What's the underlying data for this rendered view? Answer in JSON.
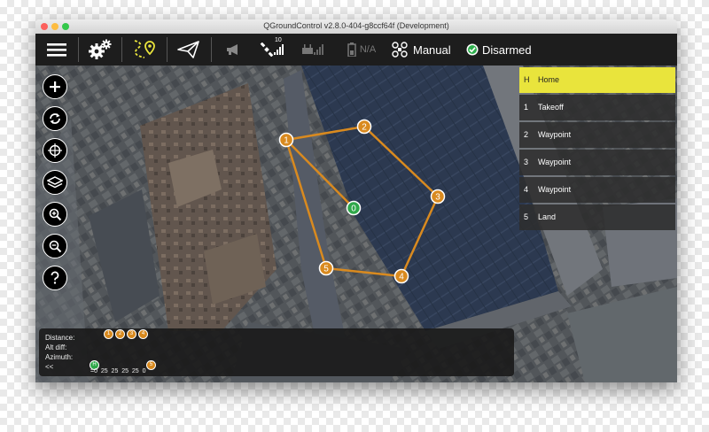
{
  "window": {
    "title": "QGroundControl v2.8.0-404-g8ccf64f (Development)"
  },
  "toolbar": {
    "menu_icon": "hamburger-menu-icon",
    "setup_icon": "gears-icon",
    "plan_icon": "waypoint-route-icon",
    "fly_icon": "paper-plane-icon",
    "gps_satellite_count": "10",
    "battery_text": "N/A",
    "flight_mode": "Manual",
    "arm_status": "Disarmed",
    "accent_color": "#e9e43c"
  },
  "map_controls": {
    "zoom_in_icon": "plus-icon",
    "sync_icon": "sync-arrows-icon",
    "center_icon": "crosshair-icon",
    "layers_icon": "layers-icon",
    "zoom_map_in_icon": "magnify-plus-icon",
    "zoom_map_out_icon": "magnify-minus-icon",
    "help_icon": "question-icon"
  },
  "mission": {
    "items": [
      {
        "num": "H",
        "label": "Home"
      },
      {
        "num": "1",
        "label": "Takeoff"
      },
      {
        "num": "2",
        "label": "Waypoint"
      },
      {
        "num": "3",
        "label": "Waypoint"
      },
      {
        "num": "4",
        "label": "Waypoint"
      },
      {
        "num": "5",
        "label": "Land"
      }
    ],
    "markers": [
      "0",
      "1",
      "2",
      "3",
      "4",
      "5"
    ]
  },
  "info_panel": {
    "distance_label": "Distance:",
    "alt_diff_label": "Alt diff:",
    "azimuth_label": "Azimuth:",
    "collapse_label": "<<",
    "top_markers": [
      "1",
      "2",
      "3",
      "4"
    ],
    "home_marker": "H",
    "land_marker": "5",
    "altitudes": "=0  25  25  25  25  0"
  }
}
